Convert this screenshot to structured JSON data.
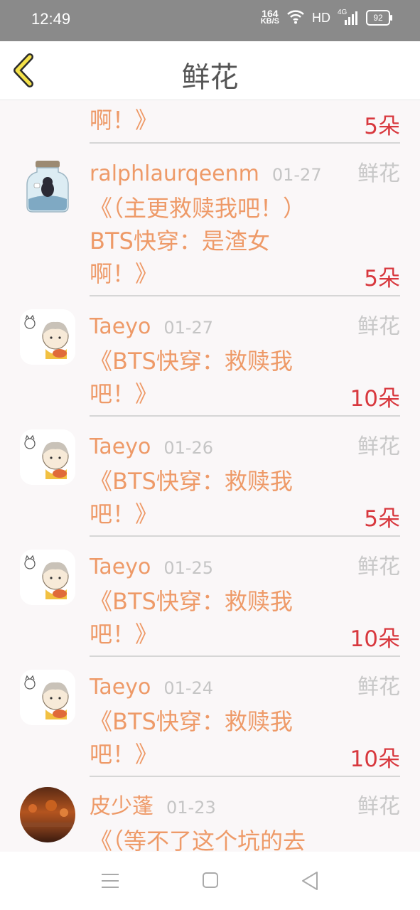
{
  "status_bar": {
    "time": "12:49",
    "net_speed": "164",
    "net_unit": "KB/S",
    "hd": "HD",
    "network": "4G",
    "battery": "92"
  },
  "header": {
    "title": "鲜花",
    "back_icon": "chevron-left-icon"
  },
  "list": {
    "top_partial": {
      "book_tail": "啊！》",
      "count": "5朵"
    },
    "items": [
      {
        "name": "ralphlaurqeenm",
        "date": "01-27",
        "type": "鲜花",
        "book_line1": "《（主更救赎我吧！）",
        "book_line2": "BTS快穿：是渣女",
        "book_line3": "啊！》",
        "count": "5朵",
        "avatar": "bottle-avatar"
      },
      {
        "name": "Taeyo",
        "date": "01-27",
        "type": "鲜花",
        "book_line1": "《BTS快穿：救赎我",
        "book_line2": "吧！》",
        "count": "10朵",
        "avatar": "cartoon-girl-avatar"
      },
      {
        "name": "Taeyo",
        "date": "01-26",
        "type": "鲜花",
        "book_line1": "《BTS快穿：救赎我",
        "book_line2": "吧！》",
        "count": "5朵",
        "avatar": "cartoon-girl-avatar"
      },
      {
        "name": "Taeyo",
        "date": "01-25",
        "type": "鲜花",
        "book_line1": "《BTS快穿：救赎我",
        "book_line2": "吧！》",
        "count": "10朵",
        "avatar": "cartoon-girl-avatar"
      },
      {
        "name": "Taeyo",
        "date": "01-24",
        "type": "鲜花",
        "book_line1": "《BTS快穿：救赎我",
        "book_line2": "吧！》",
        "count": "10朵",
        "avatar": "cartoon-girl-avatar"
      },
      {
        "name": "皮少蓬",
        "date": "01-23",
        "type": "鲜花",
        "book_line1": "《（等不了这个坑的去",
        "avatar": "autumn-photo-avatar"
      }
    ]
  },
  "bottom_nav": {
    "menu_icon": "menu-icon",
    "home_icon": "home-square-icon",
    "back_icon": "back-triangle-icon"
  },
  "colors": {
    "accent": "#ee9a68",
    "count_red": "#d8383e",
    "muted": "#c8c8c8",
    "back_yellow": "#f5e24a"
  }
}
